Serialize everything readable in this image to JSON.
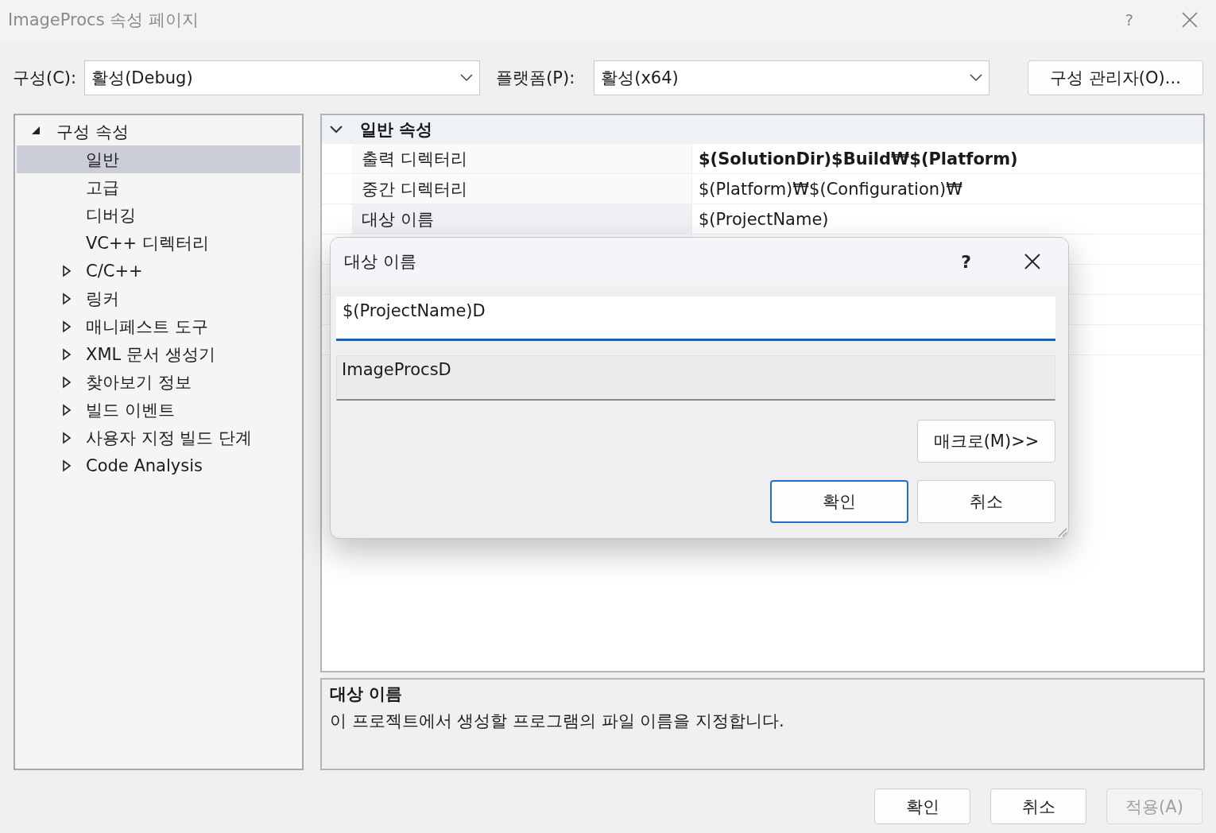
{
  "window": {
    "title": "ImageProcs 속성 페이지",
    "help": "?",
    "active": false
  },
  "toolbar": {
    "configuration": {
      "label": "구성(C):",
      "value": "활성(Debug)"
    },
    "platform": {
      "label": "플랫폼(P):",
      "value": "활성(x64)"
    },
    "manager_button": "구성 관리자(O)..."
  },
  "tree": [
    {
      "label": "구성 속성",
      "expanded": true,
      "selected": false,
      "children": [
        {
          "label": "일반",
          "kind": "leaf",
          "selected": true
        },
        {
          "label": "고급",
          "kind": "leaf",
          "selected": false
        },
        {
          "label": "디버깅",
          "kind": "leaf",
          "selected": false
        },
        {
          "label": "VC++ 디렉터리",
          "kind": "leaf",
          "selected": false
        },
        {
          "label": "C/C++",
          "kind": "group",
          "expanded": false,
          "selected": false
        },
        {
          "label": "링커",
          "kind": "group",
          "expanded": false,
          "selected": false
        },
        {
          "label": "매니페스트 도구",
          "kind": "group",
          "expanded": false,
          "selected": false
        },
        {
          "label": "XML 문서 생성기",
          "kind": "group",
          "expanded": false,
          "selected": false
        },
        {
          "label": "찾아보기 정보",
          "kind": "group",
          "expanded": false,
          "selected": false
        },
        {
          "label": "빌드 이벤트",
          "kind": "group",
          "expanded": false,
          "selected": false
        },
        {
          "label": "사용자 지정 빌드 단계",
          "kind": "group",
          "expanded": false,
          "selected": false
        },
        {
          "label": "Code Analysis",
          "kind": "group",
          "expanded": false,
          "selected": false
        }
      ]
    }
  ],
  "property_grid": {
    "section": {
      "title": "일반 속성",
      "expanded": true
    },
    "rows": [
      {
        "name": "출력 디렉터리",
        "value": "$(SolutionDir)$Build₩$(Platform)",
        "modified": true,
        "selected": false
      },
      {
        "name": "중간 디렉터리",
        "value": "$(Platform)₩$(Configuration)₩",
        "modified": false,
        "selected": false
      },
      {
        "name": "대상 이름",
        "value": "$(ProjectName)",
        "modified": false,
        "selected": true
      }
    ]
  },
  "description": {
    "title": "대상 이름",
    "text": "이 프로젝트에서 생성할 프로그램의 파일 이름을 지정합니다."
  },
  "buttons": [
    {
      "label": "확인",
      "disabled": false
    },
    {
      "label": "취소",
      "disabled": false
    },
    {
      "label": "적용(A)",
      "disabled": true
    }
  ],
  "dialog": {
    "title": "대상 이름",
    "help": "?",
    "input": {
      "value": "$(ProjectName)D"
    },
    "preview": "ImageProcsD",
    "macros_button": "매크로(M)>>",
    "buttons": [
      {
        "label": "확인",
        "default": true
      },
      {
        "label": "취소",
        "default": false
      }
    ]
  }
}
